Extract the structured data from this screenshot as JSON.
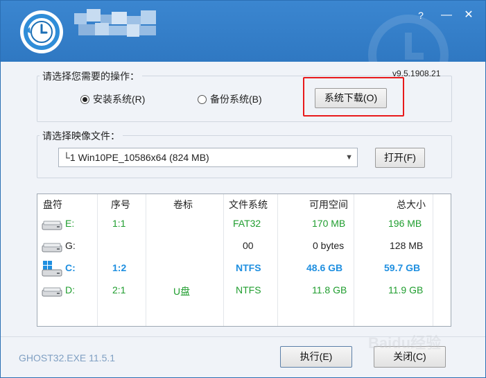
{
  "window": {
    "help_glyph": "?",
    "minimize_glyph": "—",
    "close_glyph": "✕",
    "accent_color": "#2f78c2"
  },
  "operation": {
    "group_label": "请选择您需要的操作：",
    "version": "v9.5.1908.21",
    "options": [
      {
        "label": "安装系统(R)",
        "selected": true
      },
      {
        "label": "备份系统(B)",
        "selected": false
      }
    ],
    "download_label": "系统下载(O)"
  },
  "image": {
    "group_label": "请选择映像文件：",
    "selected_file": "└1 Win10PE_10586x64 (824 MB)",
    "open_label": "打开(F)"
  },
  "partitions": {
    "headers": [
      "盘符",
      "序号",
      "卷标",
      "文件系统",
      "可用空间",
      "总大小"
    ],
    "rows": [
      {
        "drive": "E:",
        "index": "1:1",
        "label": "",
        "fs": "FAT32",
        "free": "170 MB",
        "total": "196 MB",
        "style": "green",
        "icon": "drive-icon"
      },
      {
        "drive": "G:",
        "index": "",
        "label": "",
        "fs": "00",
        "free": "0 bytes",
        "total": "128 MB",
        "style": "dark",
        "icon": "drive-icon"
      },
      {
        "drive": "C:",
        "index": "1:2",
        "label": "",
        "fs": "NTFS",
        "free": "48.6 GB",
        "total": "59.7 GB",
        "style": "blue",
        "icon": "windows-drive-icon"
      },
      {
        "drive": "D:",
        "index": "2:1",
        "label": "U盘",
        "fs": "NTFS",
        "free": "11.8 GB",
        "total": "11.9 GB",
        "style": "green",
        "icon": "drive-icon"
      }
    ]
  },
  "footer": {
    "ghost_version": "GHOST32.EXE 11.5.1",
    "run_label": "执行(E)",
    "close_label": "关闭(C)"
  },
  "watermark": {
    "text": "Baidu经验"
  },
  "colors": {
    "highlight_box": "#e8191b",
    "ok_green": "#1f9d2e",
    "system_blue": "#1f8fe0"
  }
}
